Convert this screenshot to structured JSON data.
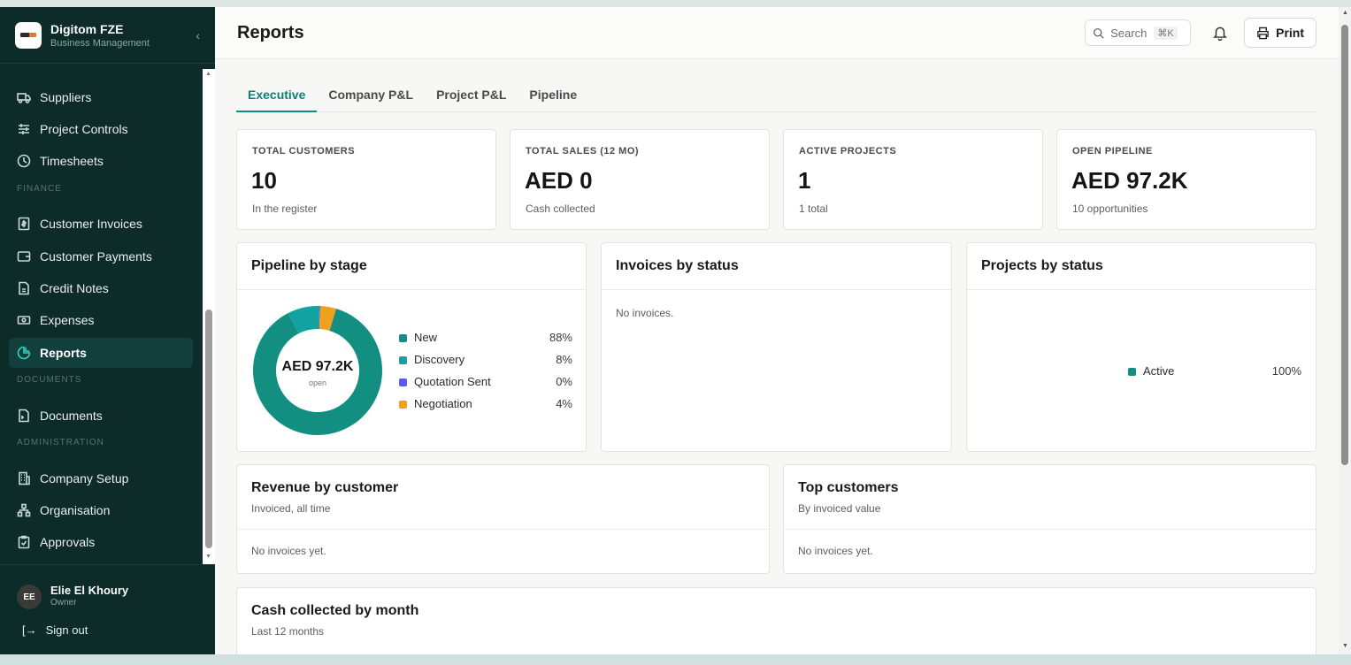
{
  "brand": {
    "name": "Digitom FZE",
    "subtitle": "Business Management"
  },
  "nav": {
    "items": [
      {
        "label": "Suppliers",
        "icon": "truck-icon"
      },
      {
        "label": "Project Controls",
        "icon": "sliders-icon"
      },
      {
        "label": "Timesheets",
        "icon": "clock-icon"
      },
      {
        "label": "Customer Invoices",
        "icon": "invoice-icon"
      },
      {
        "label": "Customer Payments",
        "icon": "wallet-icon"
      },
      {
        "label": "Credit Notes",
        "icon": "file-icon"
      },
      {
        "label": "Expenses",
        "icon": "banknote-icon"
      },
      {
        "label": "Reports",
        "icon": "pie-chart-icon",
        "active": true
      },
      {
        "label": "Documents",
        "icon": "document-icon"
      },
      {
        "label": "Company Setup",
        "icon": "building-icon"
      },
      {
        "label": "Organisation",
        "icon": "org-chart-icon"
      },
      {
        "label": "Approvals",
        "icon": "clipboard-check-icon"
      }
    ],
    "sections": {
      "finance": "FINANCE",
      "documents": "DOCUMENTS",
      "administration": "ADMINISTRATION"
    }
  },
  "user": {
    "initials": "EE",
    "name": "Elie El Khoury",
    "role": "Owner",
    "signout": "Sign out"
  },
  "header": {
    "title": "Reports",
    "search_label": "Search",
    "search_shortcut": "⌘K",
    "print_label": "Print"
  },
  "tabs": [
    "Executive",
    "Company P&L",
    "Project P&L",
    "Pipeline"
  ],
  "kpis": [
    {
      "label": "TOTAL CUSTOMERS",
      "value": "10",
      "sub": "In the register"
    },
    {
      "label": "TOTAL SALES (12 MO)",
      "value": "AED 0",
      "sub": "Cash collected"
    },
    {
      "label": "ACTIVE PROJECTS",
      "value": "1",
      "sub": "1 total"
    },
    {
      "label": "OPEN PIPELINE",
      "value": "AED 97.2K",
      "sub": "10 opportunities"
    }
  ],
  "pipeline": {
    "title": "Pipeline by stage",
    "center_value": "AED 97.2K",
    "center_label": "open",
    "stages": [
      {
        "name": "New",
        "pct_label": "88%",
        "share": 0.88,
        "color": "#138f82"
      },
      {
        "name": "Discovery",
        "pct_label": "8%",
        "share": 0.08,
        "color": "#12a3a0"
      },
      {
        "name": "Quotation Sent",
        "pct_label": "0%",
        "share": 0.0,
        "color": "#5b5ce8"
      },
      {
        "name": "Negotiation",
        "pct_label": "4%",
        "share": 0.04,
        "color": "#f0a020"
      }
    ]
  },
  "invoices_status": {
    "title": "Invoices by status",
    "empty": "No invoices."
  },
  "projects_status": {
    "title": "Projects by status",
    "items": [
      {
        "name": "Active",
        "pct_label": "100%",
        "color": "#138f82"
      }
    ]
  },
  "revenue": {
    "title": "Revenue by customer",
    "subtitle": "Invoiced, all time",
    "empty": "No invoices yet."
  },
  "top_customers": {
    "title": "Top customers",
    "subtitle": "By invoiced value",
    "empty": "No invoices yet."
  },
  "cash": {
    "title": "Cash collected by month",
    "subtitle": "Last 12 months"
  }
}
